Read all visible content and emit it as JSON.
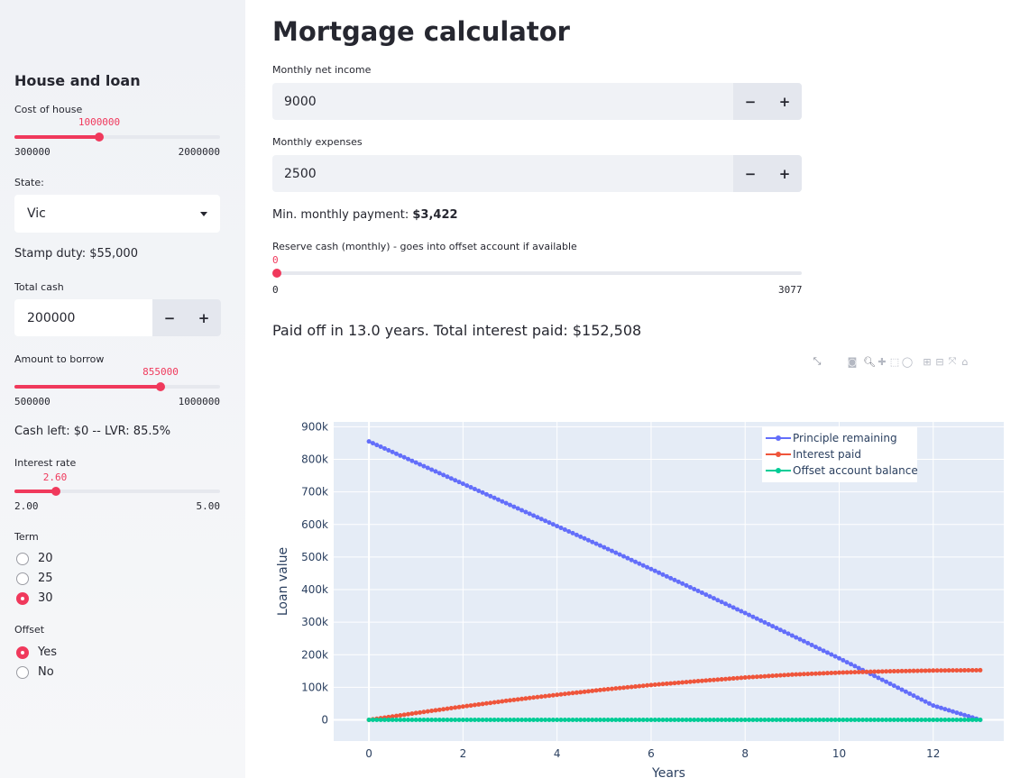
{
  "sidebar": {
    "title": "House and loan",
    "cost_of_house": {
      "label": "Cost of house",
      "value": "1000000",
      "min": "300000",
      "max": "2000000",
      "fraction": 0.412
    },
    "state": {
      "label": "State:",
      "selected": "Vic"
    },
    "stamp_duty": "Stamp duty: $55,000",
    "total_cash": {
      "label": "Total cash",
      "value": "200000",
      "minus": "−",
      "plus": "+"
    },
    "amount_to_borrow": {
      "label": "Amount to borrow",
      "value": "855000",
      "min": "500000",
      "max": "1000000",
      "fraction": 0.71
    },
    "cash_left": "Cash left: $0 -- LVR: 85.5%",
    "interest_rate": {
      "label": "Interest rate",
      "value": "2.60",
      "min": "2.00",
      "max": "5.00",
      "fraction": 0.2
    },
    "term": {
      "label": "Term",
      "options": [
        "20",
        "25",
        "30"
      ],
      "selected": "30"
    },
    "offset": {
      "label": "Offset",
      "options": [
        "Yes",
        "No"
      ],
      "selected": "Yes"
    }
  },
  "main": {
    "title": "Mortgage calculator",
    "monthly_net_income": {
      "label": "Monthly net income",
      "value": "9000",
      "minus": "−",
      "plus": "+"
    },
    "monthly_expenses": {
      "label": "Monthly expenses",
      "value": "2500",
      "minus": "−",
      "plus": "+"
    },
    "min_payment_label": "Min. monthly payment: ",
    "min_payment_value": "$3,422",
    "reserve_cash": {
      "label": "Reserve cash (monthly) - goes into offset account if available",
      "value": "0",
      "min": "0",
      "max": "3077",
      "fraction": 0.0
    },
    "summary": "Paid off in 13.0 years. Total interest paid: $152,508"
  },
  "toolbar": {
    "icons": [
      "expand-icon",
      "camera-icon",
      "zoom-icon",
      "pan-icon",
      "box-select-icon",
      "lasso-icon",
      "zoom-in-icon",
      "zoom-out-icon",
      "autoscale-icon",
      "home-icon"
    ]
  },
  "chart_data": {
    "type": "line",
    "xlabel": "Years",
    "ylabel": "Loan value",
    "xlim": [
      -0.75,
      13.5
    ],
    "ylim": [
      -65000,
      915000
    ],
    "x_ticks": [
      0,
      2,
      4,
      6,
      8,
      10,
      12
    ],
    "x_tick_labels": [
      "0",
      "2",
      "4",
      "6",
      "8",
      "10",
      "12"
    ],
    "y_ticks": [
      0,
      100000,
      200000,
      300000,
      400000,
      500000,
      600000,
      700000,
      800000,
      900000
    ],
    "y_tick_labels": [
      "0",
      "100k",
      "200k",
      "300k",
      "400k",
      "500k",
      "600k",
      "700k",
      "800k",
      "900k"
    ],
    "legend_position": "top-right",
    "grid": true,
    "series": [
      {
        "name": "Principle remaining",
        "color": "#636efa",
        "x": [
          0,
          1,
          2,
          3,
          4,
          5,
          6,
          7,
          8,
          9,
          10,
          11,
          12,
          13
        ],
        "y": [
          855000,
          790000,
          725000,
          660000,
          595000,
          530000,
          463000,
          396000,
          328000,
          259000,
          189000,
          117000,
          44000,
          0
        ]
      },
      {
        "name": "Interest paid",
        "color": "#ef553b",
        "x": [
          0,
          1,
          2,
          3,
          4,
          5,
          6,
          7,
          8,
          9,
          10,
          11,
          12,
          13
        ],
        "y": [
          0,
          21000,
          41000,
          60000,
          77000,
          93000,
          107000,
          119000,
          130000,
          139000,
          145000,
          149000,
          151500,
          152508
        ]
      },
      {
        "name": "Offset account balance",
        "color": "#00cc96",
        "x": [
          0,
          1,
          2,
          3,
          4,
          5,
          6,
          7,
          8,
          9,
          10,
          11,
          12,
          13
        ],
        "y": [
          0,
          0,
          0,
          0,
          0,
          0,
          0,
          0,
          0,
          0,
          0,
          0,
          0,
          0
        ]
      }
    ]
  }
}
